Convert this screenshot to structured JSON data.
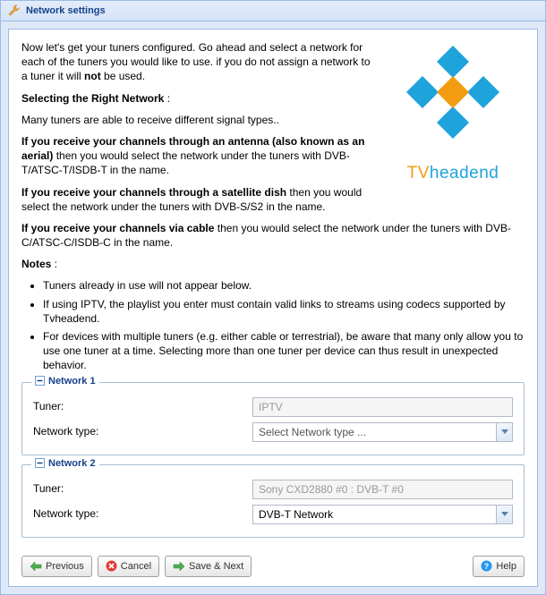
{
  "window": {
    "title": "Network settings"
  },
  "brand": {
    "name": "TVheadend",
    "highlight_prefix": "TV"
  },
  "intro": {
    "p1_a": "Now let's get your tuners configured. Go ahead and select a network for each of the tuners you would like to use. if you do not assign a network to a tuner it will ",
    "p1_b": "not",
    "p1_c": " be used.",
    "h1": "Selecting the Right Network",
    "colon": " :",
    "p2": "Many tuners are able to receive different signal types..",
    "p3_a": "If you receive your channels through an antenna (also known as an aerial)",
    "p3_b": " then you would select the network under the tuners with DVB-T/ATSC-T/ISDB-T in the name.",
    "p4_a": "If you receive your channels through a satellite dish",
    "p4_b": " then you would select the network under the tuners with DVB-S/S2 in the name.",
    "p5_a": "If you receive your channels via cable",
    "p5_b": " then you would select the network under the tuners with DVB-C/ATSC-C/ISDB-C in the name.",
    "notes_h": "Notes",
    "notes": [
      "Tuners already in use will not appear below.",
      "If using IPTV, the playlist you enter must contain valid links to streams using codecs supported by Tvheadend.",
      "For devices with multiple tuners (e.g. either cable or terrestrial), be aware that many only allow you to use one tuner at a time. Selecting more than one tuner per device can thus result in unexpected behavior."
    ]
  },
  "labels": {
    "tuner": "Tuner:",
    "network_type": "Network type:"
  },
  "networks": [
    {
      "legend": "Network 1",
      "tuner_value": "IPTV",
      "type_value": "Select Network type ...",
      "type_selected": false
    },
    {
      "legend": "Network 2",
      "tuner_value": "Sony CXD2880 #0 : DVB-T #0",
      "type_value": "DVB-T Network",
      "type_selected": true
    }
  ],
  "buttons": {
    "previous": "Previous",
    "cancel": "Cancel",
    "save_next": "Save & Next",
    "help": "Help"
  }
}
